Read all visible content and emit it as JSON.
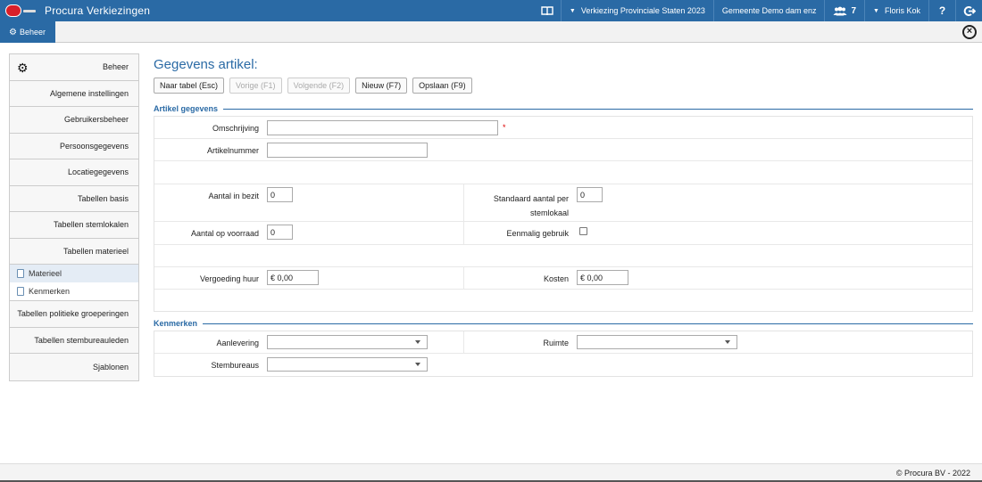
{
  "app": {
    "title": "Procura Verkiezingen"
  },
  "topbar": {
    "election": "Verkiezing Provinciale Staten 2023",
    "municipality": "Gemeente Demo dam enz",
    "users_count": "7",
    "user": "Floris Kok",
    "help": "?"
  },
  "subbar": {
    "tab": "Beheer"
  },
  "sidebar": {
    "head": "Beheer",
    "items": [
      "Algemene instellingen",
      "Gebruikersbeheer",
      "Persoonsgegevens",
      "Locatiegegevens",
      "Tabellen basis",
      "Tabellen stemlokalen",
      "Tabellen materieel"
    ],
    "subitems": [
      "Materieel",
      "Kenmerken"
    ],
    "items_after": [
      "Tabellen politieke groeperingen",
      "Tabellen stembureauleden",
      "Sjablonen"
    ]
  },
  "main": {
    "title": "Gegevens artikel:",
    "buttons": {
      "back": "Naar tabel (Esc)",
      "prev": "Vorige (F1)",
      "next": "Volgende (F2)",
      "new": "Nieuw (F7)",
      "save": "Opslaan (F9)"
    }
  },
  "artikel": {
    "section": "Artikel gegevens",
    "omschrijving_label": "Omschrijving",
    "omschrijving_value": "",
    "required_mark": "*",
    "artikelnummer_label": "Artikelnummer",
    "artikelnummer_value": "",
    "aantal_bezit_label": "Aantal in bezit",
    "aantal_bezit_value": "0",
    "standaard_label_1": "Standaard aantal per",
    "standaard_label_2": "stemlokaal",
    "standaard_value": "0",
    "aantal_voorraad_label": "Aantal op voorraad",
    "aantal_voorraad_value": "0",
    "eenmalig_label": "Eenmalig gebruik",
    "vergoeding_label": "Vergoeding huur",
    "vergoeding_value": "€ 0,00",
    "kosten_label": "Kosten",
    "kosten_value": "€ 0,00"
  },
  "kenmerken": {
    "section": "Kenmerken",
    "aanlevering_label": "Aanlevering",
    "ruimte_label": "Ruimte",
    "stembureaus_label": "Stembureaus"
  },
  "footer": {
    "copyright": "© Procura BV - 2022"
  }
}
